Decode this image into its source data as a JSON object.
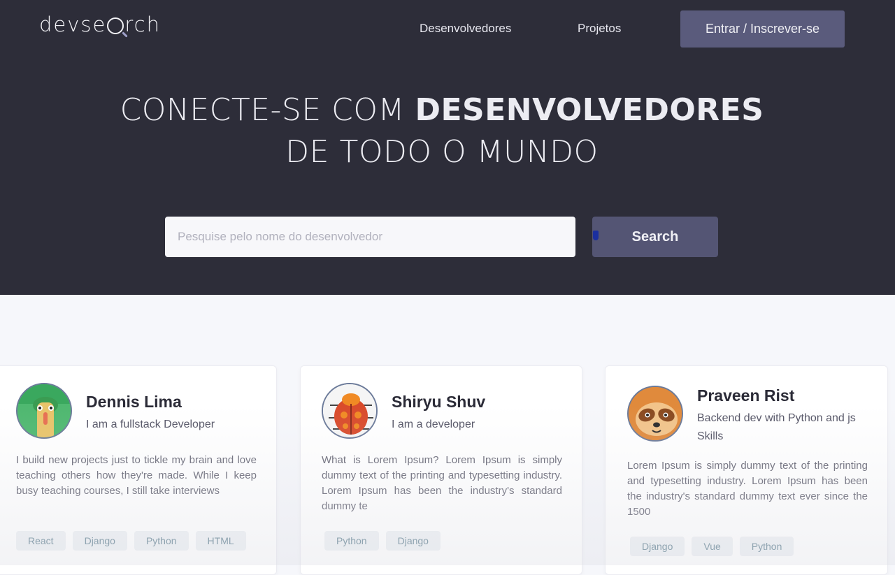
{
  "header": {
    "logo_left": "devse",
    "logo_right": "rch",
    "nav": [
      {
        "label": "Desenvolvedores"
      },
      {
        "label": "Projetos"
      }
    ],
    "login_label": "Entrar / Inscrever-se"
  },
  "hero": {
    "title_light": "CONECTE-SE COM ",
    "title_bold": "DESENVOLVEDORES",
    "title_line2": "DE TODO O MUNDO",
    "search_placeholder": "Pesquise pelo nome do desenvolvedor",
    "search_value": "",
    "search_button": "Search"
  },
  "developers": [
    {
      "name": "Dennis Lima",
      "tagline": "I am a fullstack Developer",
      "bio": "I build new projects just to tickle my brain and love teaching others how they're made. While I keep busy teaching courses, I still take interviews",
      "tags": [
        "React",
        "Django",
        "Python",
        "HTML"
      ],
      "avatar_icon": "ostrich-avatar-icon"
    },
    {
      "name": "Shiryu Shuv",
      "tagline": "I am a developer",
      "bio": "What is Lorem Ipsum? Lorem Ipsum is simply dummy text of the printing and typesetting industry. Lorem Ipsum has been the industry's standard dummy te",
      "tags": [
        "Python",
        "Django"
      ],
      "avatar_icon": "ladybug-avatar-icon"
    },
    {
      "name": "Praveen Rist",
      "tagline": "Backend dev with Python and js Skills",
      "bio": "Lorem Ipsum is simply dummy text of the printing and typesetting industry. Lorem Ipsum has been the industry's standard dummy text ever since the 1500",
      "tags": [
        "Django",
        "Vue",
        "Python"
      ],
      "avatar_icon": "sloth-avatar-icon"
    }
  ],
  "colors": {
    "hero_bg": "#2d2d39",
    "button_bg": "#545574",
    "page_bg": "#f6f7fb",
    "tag_text": "#6c8a99"
  }
}
